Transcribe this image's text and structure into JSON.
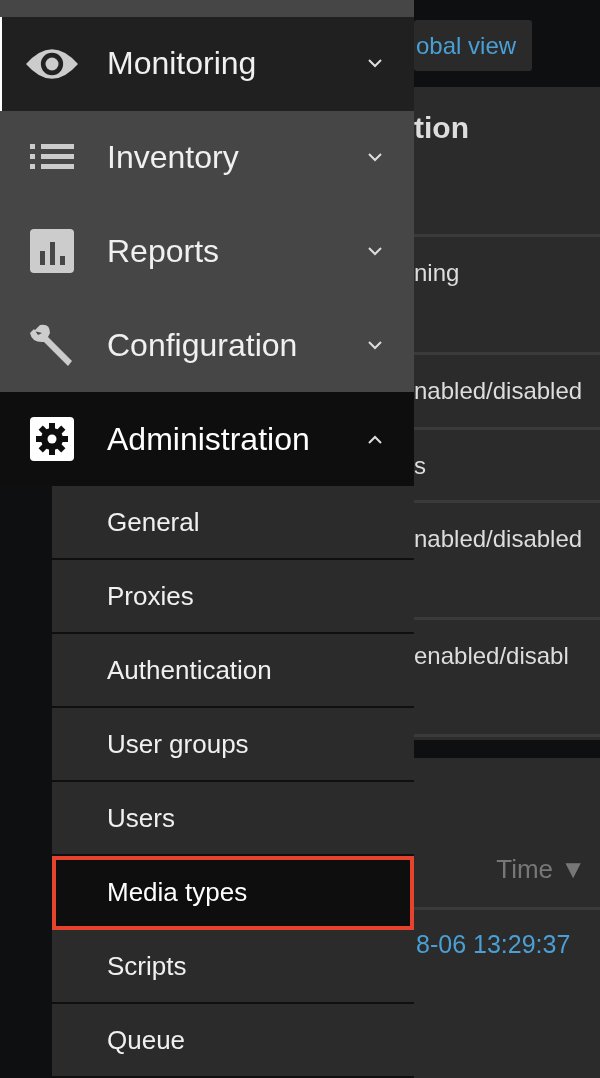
{
  "menu": [
    {
      "label": "Monitoring",
      "kind": "eye",
      "selected": true,
      "expanded": false
    },
    {
      "label": "Inventory",
      "kind": "list",
      "selected": false,
      "expanded": false
    },
    {
      "label": "Reports",
      "kind": "chart",
      "selected": false,
      "expanded": false
    },
    {
      "label": "Configuration",
      "kind": "wrench",
      "selected": false,
      "expanded": false
    },
    {
      "label": "Administration",
      "kind": "gear",
      "selected": false,
      "expanded": true,
      "children": [
        {
          "label": "General",
          "selected": false,
          "highlighted": false
        },
        {
          "label": "Proxies",
          "selected": false,
          "highlighted": false
        },
        {
          "label": "Authentication",
          "selected": false,
          "highlighted": false
        },
        {
          "label": "User groups",
          "selected": false,
          "highlighted": false
        },
        {
          "label": "Users",
          "selected": false,
          "highlighted": false
        },
        {
          "label": "Media types",
          "selected": true,
          "highlighted": true
        },
        {
          "label": "Scripts",
          "selected": false,
          "highlighted": false
        },
        {
          "label": "Queue",
          "selected": false,
          "highlighted": false
        }
      ]
    }
  ],
  "content": {
    "header_button": "obal view",
    "panel_title": "tion",
    "rows": [
      "ning",
      "nabled/disabled",
      "s",
      "nabled/disabled",
      "enabled/disabl"
    ],
    "table": {
      "column_header": "Time ▼",
      "rows": [
        "8-06 13:29:37"
      ]
    }
  }
}
